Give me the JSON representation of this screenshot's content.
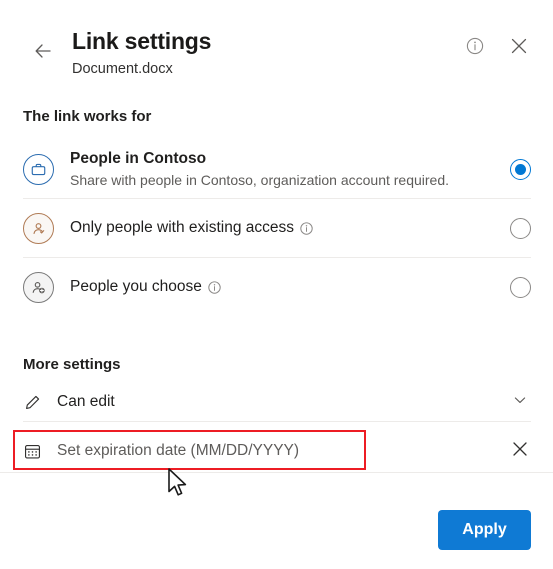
{
  "header": {
    "title": "Link settings",
    "subtitle": "Document.docx",
    "back_icon": "arrow-left-icon",
    "info_icon": "info-circle-icon",
    "close_icon": "close-icon"
  },
  "link_works_for": {
    "label": "The link works for",
    "options": [
      {
        "icon": "briefcase-icon",
        "title": "People in Contoso",
        "description": "Share with people in Contoso, organization account required.",
        "has_info": false,
        "selected": true
      },
      {
        "icon": "person-check-icon",
        "title": "Only people with existing access",
        "description": "",
        "has_info": true,
        "selected": false
      },
      {
        "icon": "person-add-icon",
        "title": "People you choose",
        "description": "",
        "has_info": true,
        "selected": false
      }
    ]
  },
  "more_settings": {
    "label": "More settings",
    "permission": {
      "icon": "pencil-icon",
      "label": "Can edit",
      "chevron": "chevron-down-icon"
    },
    "expiration": {
      "icon": "calendar-icon",
      "placeholder": "Set expiration date (MM/DD/YYYY)",
      "value": "",
      "clear_icon": "close-icon",
      "highlighted": true
    }
  },
  "footer": {
    "apply_label": "Apply"
  },
  "colors": {
    "accent": "#0078d4",
    "apply_button": "#0f7ad4",
    "highlight_box": "#ed1c24",
    "org_icon": "#2b6cb0",
    "existing_icon": "#b07b55",
    "choose_icon": "#7a7a7a",
    "divider": "#edebe9",
    "secondary_text": "#5e5c5a"
  },
  "cursor": {
    "icon": "mouse-pointer-icon"
  }
}
